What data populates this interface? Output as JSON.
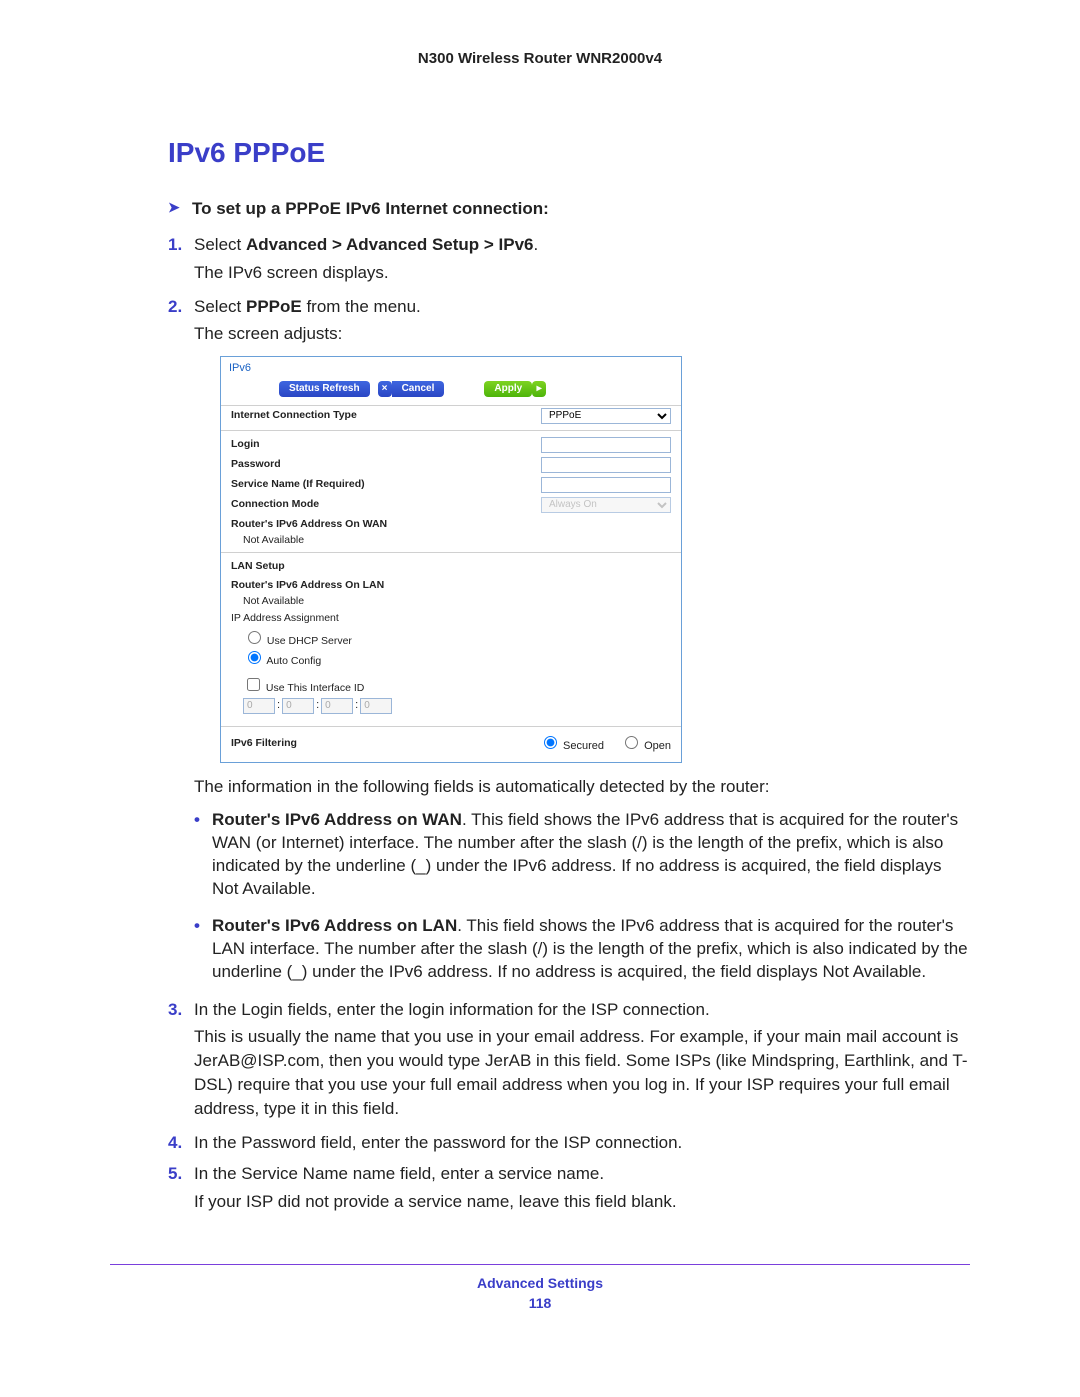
{
  "header": {
    "product": "N300 Wireless Router WNR2000v4"
  },
  "section": {
    "heading": "IPv6 PPPoE"
  },
  "lead": "To set up a PPPoE IPv6 Internet connection:",
  "steps": {
    "s1_pre": "Select ",
    "s1_bold": "Advanced > Advanced Setup > IPv6",
    "s1_post": ".",
    "s1_sub": "The IPv6 screen displays.",
    "s2_pre": "Select ",
    "s2_bold": "PPPoE",
    "s2_post": " from the menu.",
    "s2_sub": "The screen adjusts:",
    "detected_intro": "The information in the following fields is automatically detected by the router:",
    "bullet_wan_bold": "Router's IPv6 Address on WAN",
    "bullet_wan_text": ". This field shows the IPv6 address that is acquired for the router's WAN (or Internet) interface. The number after the slash (/) is the length of the prefix, which is also indicated by the underline (_) under the IPv6 address. If no address is acquired, the field displays Not Available.",
    "bullet_lan_bold": "Router's IPv6 Address on LAN",
    "bullet_lan_text": ". This field shows the IPv6 address that is acquired for the router's LAN interface. The number after the slash (/) is the length of the prefix, which is also indicated by the underline (_) under the IPv6 address. If no address is acquired, the field displays Not Available.",
    "s3": "In the Login fields, enter the login information for the ISP connection.",
    "s3_sub": "This is usually the name that you use in your email address. For example, if your main mail account is JerAB@ISP.com, then you would type JerAB in this field. Some ISPs (like Mindspring, Earthlink, and T-DSL) require that you use your full email address when you log in. If your ISP requires your full email address, type it in this field.",
    "s4": "In the Password field, enter the password for the ISP connection.",
    "s5": "In the Service Name name field, enter a service name.",
    "s5_sub": "If your ISP did not provide a service name, leave this field blank."
  },
  "screenshot": {
    "tab": "IPv6",
    "buttons": {
      "status_refresh": "Status Refresh",
      "cancel_x": "×",
      "cancel": "Cancel",
      "apply": "Apply",
      "apply_arrow": "▸"
    },
    "labels": {
      "conn_type": "Internet Connection Type",
      "login": "Login",
      "password": "Password",
      "service": "Service Name (If Required)",
      "conn_mode": "Connection Mode",
      "wan_addr": "Router's IPv6 Address On WAN",
      "not_available": "Not Available",
      "lan_setup": "LAN Setup",
      "lan_addr": "Router's IPv6 Address On LAN",
      "ip_assign": "IP Address Assignment",
      "use_dhcp": "Use DHCP Server",
      "auto_config": "Auto Config",
      "use_iid": "Use This Interface ID",
      "filtering": "IPv6 Filtering",
      "secured": "Secured",
      "open": "Open"
    },
    "values": {
      "conn_type": "PPPoE",
      "conn_mode": "Always On",
      "iid": [
        "0",
        "0",
        "0",
        "0"
      ],
      "ip_assign_selected": "auto_config",
      "filtering_selected": "secured"
    }
  },
  "footer": {
    "title": "Advanced Settings",
    "page": "118"
  }
}
